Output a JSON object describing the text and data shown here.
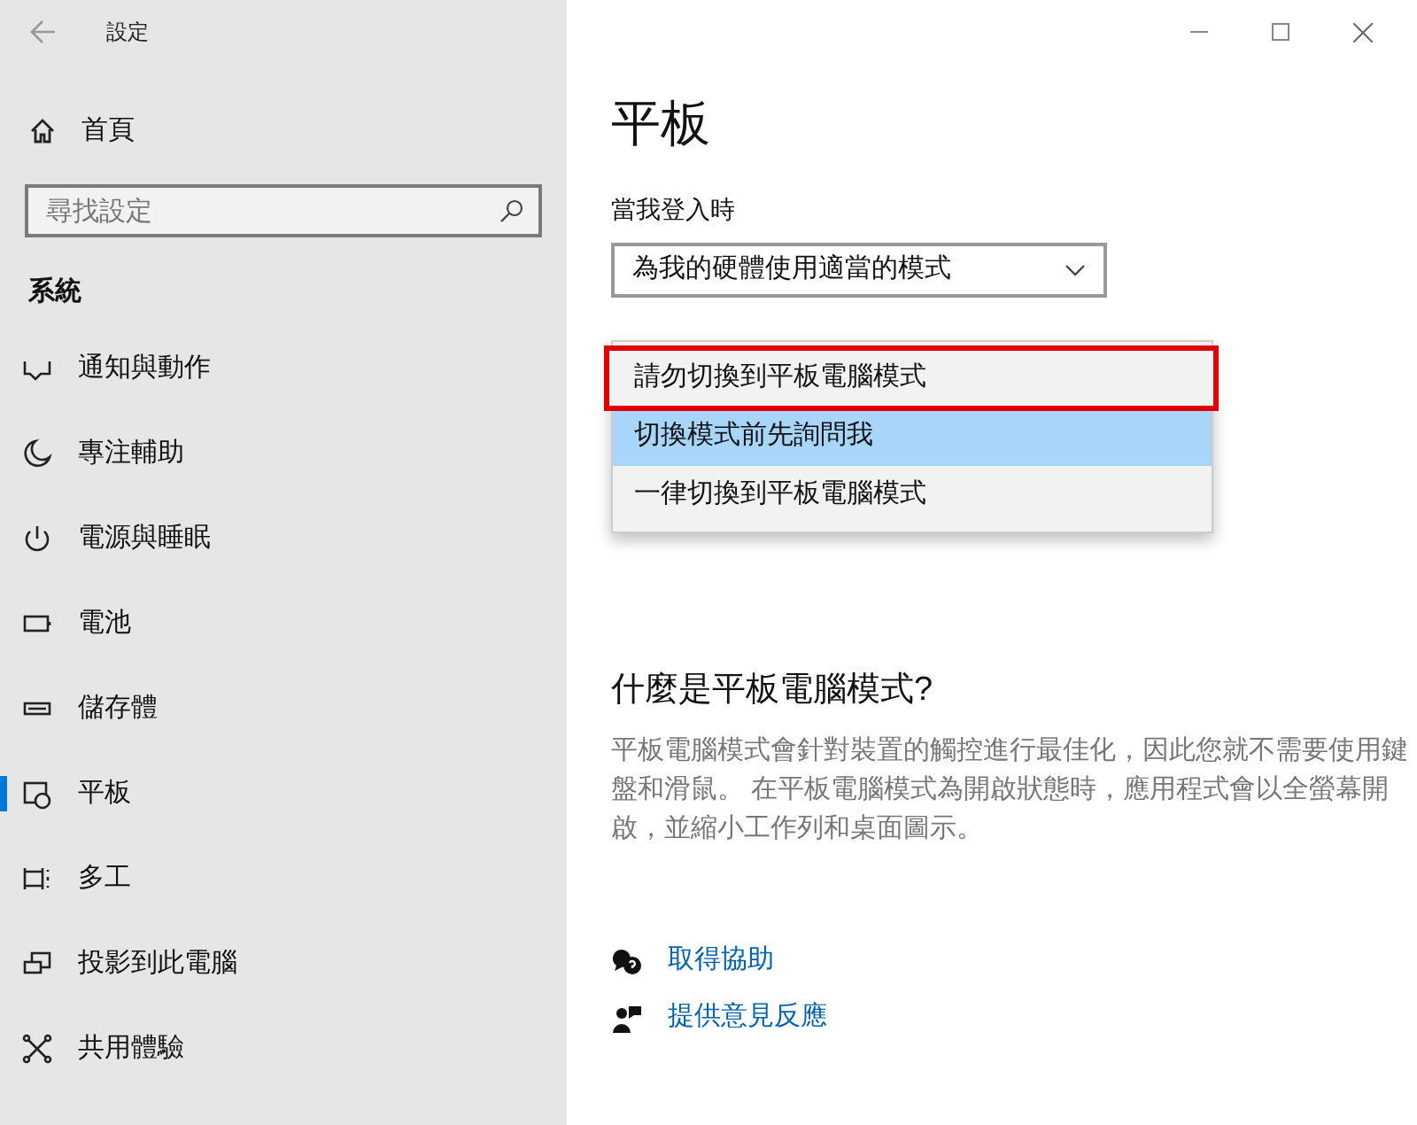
{
  "window": {
    "title": "設定"
  },
  "sidebar": {
    "home": "首頁",
    "search": {
      "placeholder": "尋找設定"
    },
    "section": "系統",
    "items": [
      {
        "label": "通知與動作",
        "selected": false
      },
      {
        "label": "專注輔助",
        "selected": false
      },
      {
        "label": "電源與睡眠",
        "selected": false
      },
      {
        "label": "電池",
        "selected": false
      },
      {
        "label": "儲存體",
        "selected": false
      },
      {
        "label": "平板",
        "selected": true
      },
      {
        "label": "多工",
        "selected": false
      },
      {
        "label": "投影到此電腦",
        "selected": false
      },
      {
        "label": "共用體驗",
        "selected": false
      }
    ]
  },
  "main": {
    "title": "平板",
    "login_label": "當我登入時",
    "login_dropdown": "為我的硬體使用適當的模式",
    "dropdown_menu": [
      {
        "label": "請勿切換到平板電腦模式",
        "selected": false,
        "marked": true
      },
      {
        "label": "切換模式前先詢問我",
        "selected": true,
        "marked": false
      },
      {
        "label": "一律切換到平板電腦模式",
        "selected": false,
        "marked": false
      }
    ],
    "info_heading": "什麼是平板電腦模式?",
    "info_text": "平板電腦模式會針對裝置的觸控進行最佳化，因此您就不需要使用鍵盤和滑鼠。 在平板電腦模式為開啟狀態時，應用程式會以全螢幕開啟，並縮小工作列和桌面圖示。",
    "links": [
      {
        "label": "取得協助"
      },
      {
        "label": "提供意見反應"
      }
    ]
  }
}
